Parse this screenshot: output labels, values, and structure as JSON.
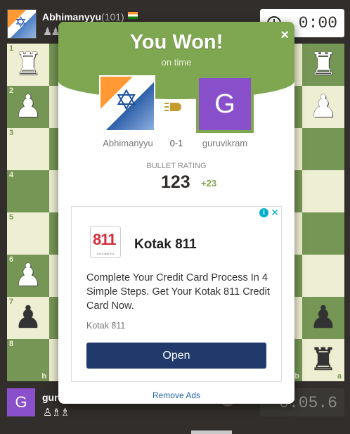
{
  "top_player": {
    "name": "Abhimanyyu",
    "rating": "(101)",
    "captured_pieces": "♟♟",
    "clock": "0:00"
  },
  "bottom_player": {
    "name": "gur",
    "avatar_letter": "G",
    "captured_pieces": "♙♗♗",
    "clock": "0:05.6"
  },
  "board": {
    "ranks": [
      "1",
      "2",
      "3",
      "4",
      "5",
      "6",
      "7",
      "8"
    ],
    "files_visible": [
      "h",
      "b",
      "a"
    ],
    "pieces": {
      "left_r1": "♜",
      "left_r2": "♟",
      "left_r6": "♟",
      "left_r7": "♟",
      "right_r1": "♜",
      "right_r2": "♟",
      "right_r7": "♟",
      "right_r8": "♜"
    }
  },
  "modal": {
    "title": "You Won!",
    "subtitle": "on time",
    "close": "×",
    "winner_name": "Abhimanyyu",
    "score": "0-1",
    "loser_name": "guruvikram",
    "loser_avatar_letter": "G",
    "rating_label": "BULLET RATING",
    "rating_value": "123",
    "rating_delta": "+23",
    "remove_ads": "Remove Ads"
  },
  "ad": {
    "logo_text": "811",
    "logo_subtext": "Get Kotak 811",
    "brand": "Kotak 811",
    "copy": "Complete Your Credit Card Process In 4 Simple Steps. Get Your Kotak 811 Credit Card Now.",
    "source": "Kotak 811",
    "button": "Open",
    "info": "i",
    "close": "✕"
  },
  "colors": {
    "board_light": "#eeeed2",
    "board_dark": "#769656",
    "modal_green": "#7fa650",
    "ad_button": "#213a6b",
    "avatar_purple": "#8a4fcb"
  }
}
